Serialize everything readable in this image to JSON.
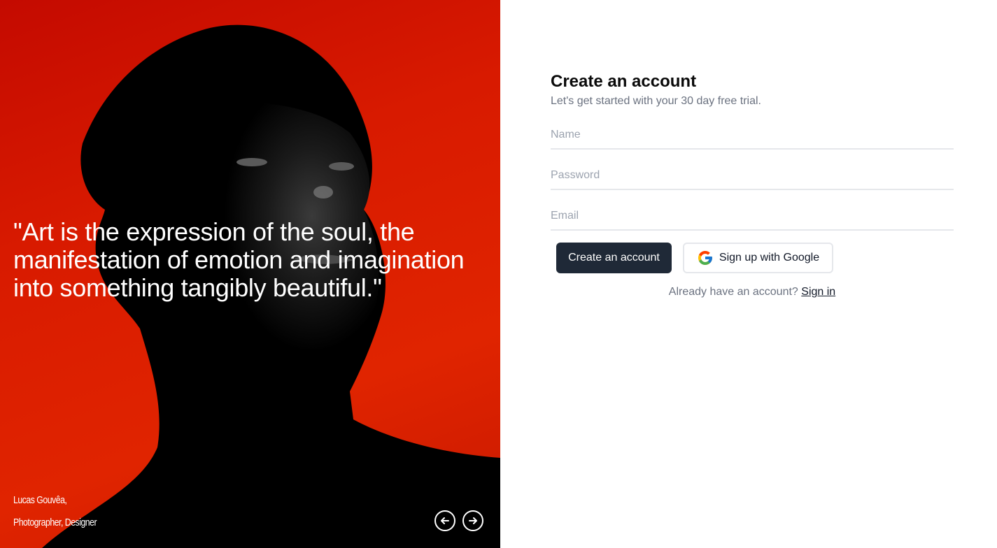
{
  "hero": {
    "quote": "\"Art is the expression of the soul, the manifestation of emotion and imagination into something tangibly beautiful.\"",
    "author_name": "Lucas Gouvêa,",
    "author_role": "Photographer, Designer",
    "accent_color": "#d81a00",
    "prev_icon": "arrow-left-circle-icon",
    "next_icon": "arrow-right-circle-icon"
  },
  "form": {
    "title": "Create an account",
    "subtitle": "Let's get started with your 30 day free trial.",
    "fields": {
      "name_placeholder": "Name",
      "password_placeholder": "Password",
      "email_placeholder": "Email"
    },
    "create_button": "Create an account",
    "google_button": "Sign up with Google",
    "google_icon": "google-logo-icon",
    "signin_prompt": "Already have an account?",
    "signin_link": "Sign in",
    "primary_color": "#1f2937"
  }
}
